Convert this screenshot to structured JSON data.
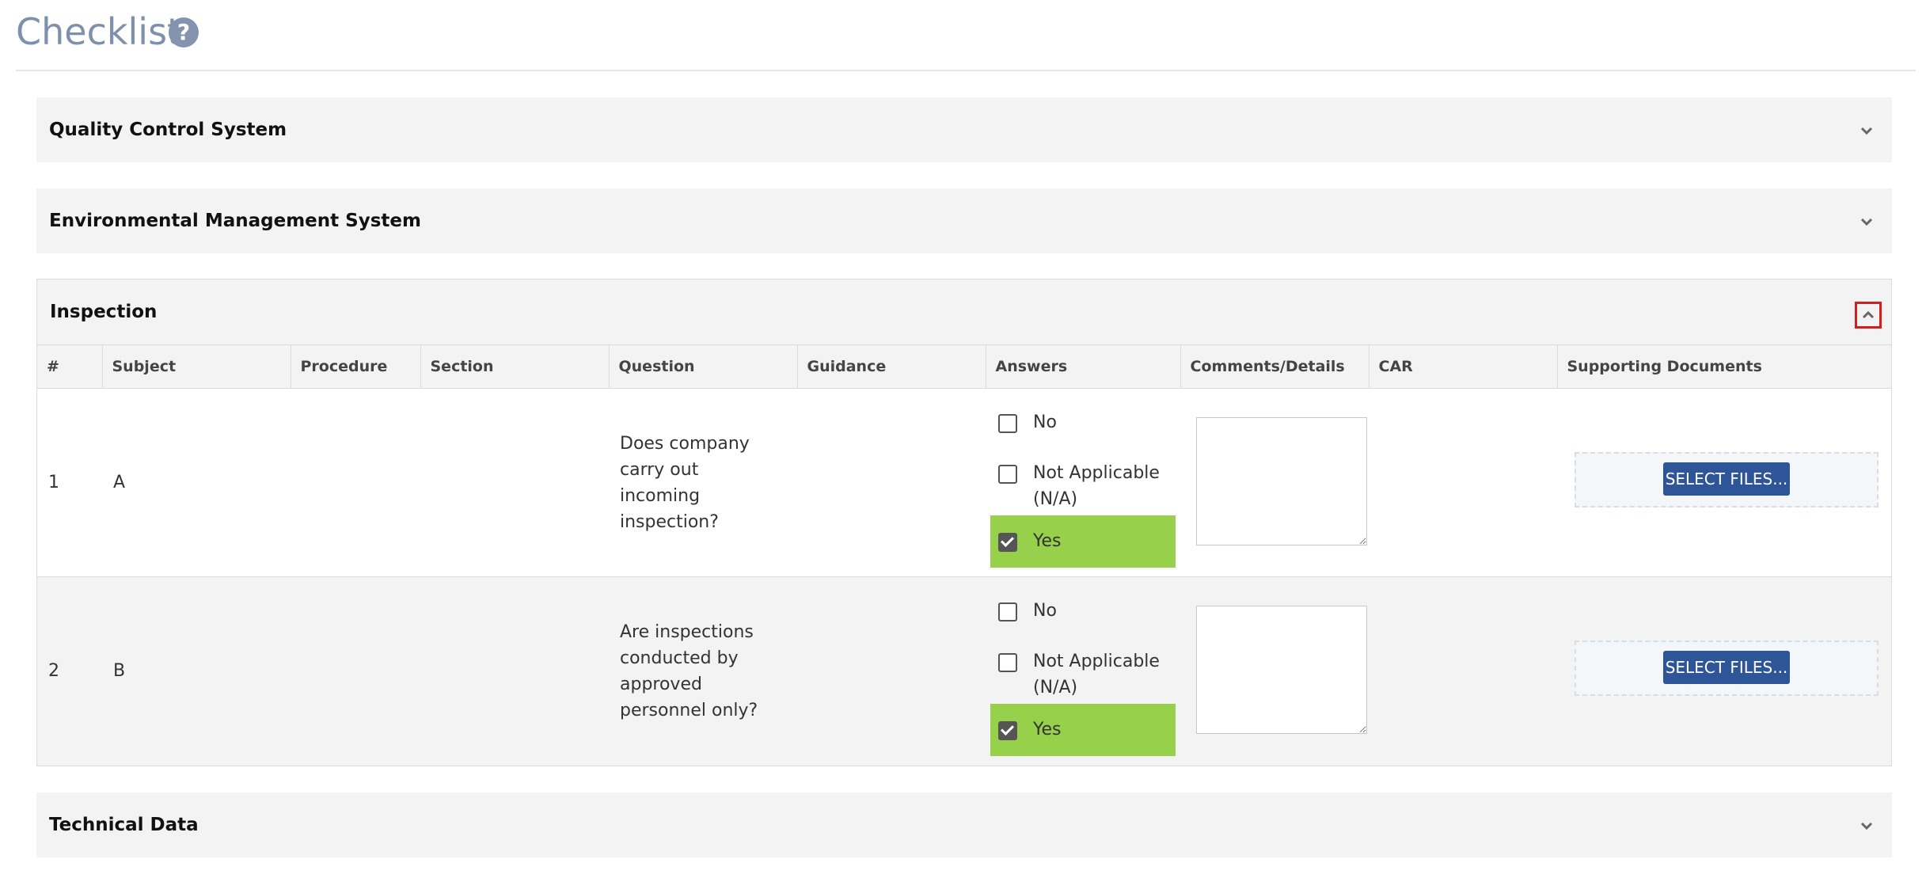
{
  "page": {
    "title": "Checklist",
    "help_glyph": "?"
  },
  "sections": [
    {
      "title": "Quality Control System",
      "expanded": false
    },
    {
      "title": "Environmental Management System",
      "expanded": false
    },
    {
      "title": "Inspection",
      "expanded": true
    },
    {
      "title": "Technical Data",
      "expanded": false
    }
  ],
  "table": {
    "columns": [
      "#",
      "Subject",
      "Procedure",
      "Section",
      "Question",
      "Guidance",
      "Answers",
      "Comments/Details",
      "CAR",
      "Supporting Documents"
    ],
    "rows": [
      {
        "num": "1",
        "subject": "A",
        "procedure": "",
        "section": "",
        "question": "Does company carry out incoming inspection?",
        "guidance": "",
        "car": "",
        "comment": "",
        "answers": [
          {
            "label": "No",
            "checked": false
          },
          {
            "label": "Not Applicable (N/A)",
            "checked": false
          },
          {
            "label": "Yes",
            "checked": true
          }
        ],
        "select_files_label": "SELECT FILES..."
      },
      {
        "num": "2",
        "subject": "B",
        "procedure": "",
        "section": "",
        "question": "Are inspections conducted by approved personnel only?",
        "guidance": "",
        "car": "",
        "comment": "",
        "answers": [
          {
            "label": "No",
            "checked": false
          },
          {
            "label": "Not Applicable (N/A)",
            "checked": false
          },
          {
            "label": "Yes",
            "checked": true
          }
        ],
        "select_files_label": "SELECT FILES..."
      }
    ]
  },
  "colors": {
    "title": "#7d90ac",
    "answer_selected": "#97d04a",
    "button": "#2d5597",
    "highlight_border": "#d41f1f"
  },
  "icons": {
    "help": "question-circle-icon",
    "collapsed": "chevron-down-icon",
    "expanded": "chevron-up-icon"
  }
}
